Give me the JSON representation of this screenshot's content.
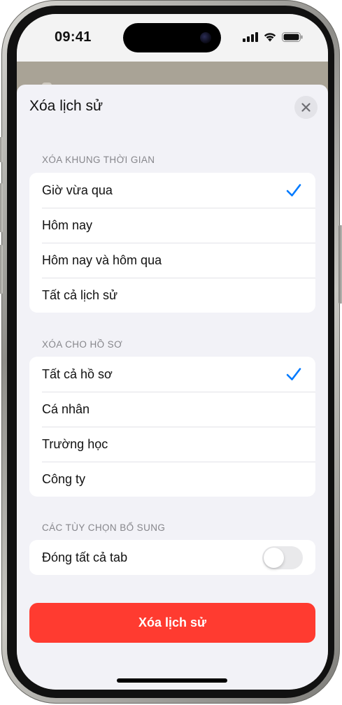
{
  "status_bar": {
    "time": "09:41"
  },
  "sheet": {
    "title": "Xóa lịch sử",
    "close_icon": "xmark-icon"
  },
  "timeframe_section": {
    "header": "XÓA KHUNG THỜI GIAN",
    "options": [
      {
        "label": "Giờ vừa qua",
        "selected": true
      },
      {
        "label": "Hôm nay",
        "selected": false
      },
      {
        "label": "Hôm nay và hôm qua",
        "selected": false
      },
      {
        "label": "Tất cả lịch sử",
        "selected": false
      }
    ]
  },
  "profile_section": {
    "header": "XÓA CHO HỒ SƠ",
    "options": [
      {
        "label": "Tất cả hồ sơ",
        "selected": true
      },
      {
        "label": "Cá nhân",
        "selected": false
      },
      {
        "label": "Trường học",
        "selected": false
      },
      {
        "label": "Công ty",
        "selected": false
      }
    ]
  },
  "additional_section": {
    "header": "CÁC TÙY CHỌN BỔ SUNG",
    "close_all_tabs_label": "Đóng tất cả tab",
    "close_all_tabs_on": false
  },
  "clear_button": {
    "label": "Xóa lịch sử"
  },
  "colors": {
    "accent_blue": "#007aff",
    "destructive_red": "#ff3b30",
    "sheet_background": "#f2f2f7"
  }
}
